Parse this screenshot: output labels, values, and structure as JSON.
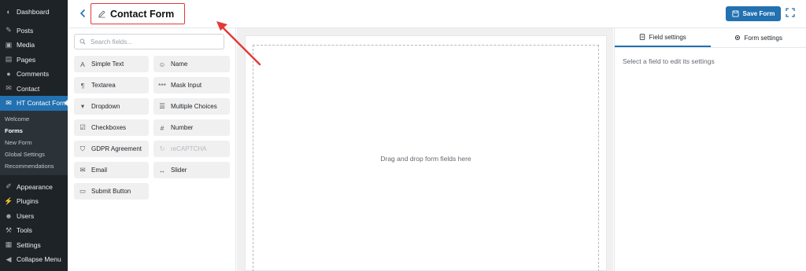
{
  "wp_menu": {
    "items_top": [
      {
        "label": "Dashboard",
        "icon": "dashboard-icon"
      },
      {
        "label": "Posts",
        "icon": "pin-icon"
      },
      {
        "label": "Media",
        "icon": "media-icon"
      },
      {
        "label": "Pages",
        "icon": "pages-icon"
      },
      {
        "label": "Comments",
        "icon": "comments-icon"
      },
      {
        "label": "Contact",
        "icon": "mail-icon"
      },
      {
        "label": "HT Contact Form",
        "icon": "mail-icon"
      }
    ],
    "submenu": [
      "Welcome",
      "Forms",
      "New Form",
      "Global Settings",
      "Recommendations"
    ],
    "items_bottom": [
      {
        "label": "Appearance",
        "icon": "brush-icon"
      },
      {
        "label": "Plugins",
        "icon": "plug-icon"
      },
      {
        "label": "Users",
        "icon": "users-icon"
      },
      {
        "label": "Tools",
        "icon": "wrench-icon"
      },
      {
        "label": "Settings",
        "icon": "settings-icon"
      }
    ],
    "collapse_label": "Collapse Menu"
  },
  "header": {
    "title": "Contact Form",
    "save_label": "Save Form"
  },
  "fields": {
    "search_placeholder": "Search fields...",
    "items": [
      {
        "label": "Simple Text",
        "icon": "text-icon"
      },
      {
        "label": "Name",
        "icon": "user-icon"
      },
      {
        "label": "Textarea",
        "icon": "paragraph-icon"
      },
      {
        "label": "Mask Input",
        "icon": "mask-icon"
      },
      {
        "label": "Dropdown",
        "icon": "dropdown-icon"
      },
      {
        "label": "Multiple Choices",
        "icon": "list-icon"
      },
      {
        "label": "Checkboxes",
        "icon": "checkbox-icon"
      },
      {
        "label": "Number",
        "icon": "hash-icon"
      },
      {
        "label": "GDPR Agreement",
        "icon": "shield-icon"
      },
      {
        "label": "reCAPTCHA",
        "icon": "recaptcha-icon"
      },
      {
        "label": "Email",
        "icon": "envelope-icon"
      },
      {
        "label": "Slider",
        "icon": "slider-icon"
      },
      {
        "label": "Submit Button",
        "icon": "button-icon"
      }
    ]
  },
  "canvas": {
    "drop_hint": "Drag and drop form fields here"
  },
  "settings": {
    "tabs": [
      "Field settings",
      "Form settings"
    ],
    "hint": "Select a field to edit its settings"
  },
  "colors": {
    "accent": "#2271b1",
    "annotation": "#e53935",
    "wp_sidebar": "#1d2327"
  }
}
